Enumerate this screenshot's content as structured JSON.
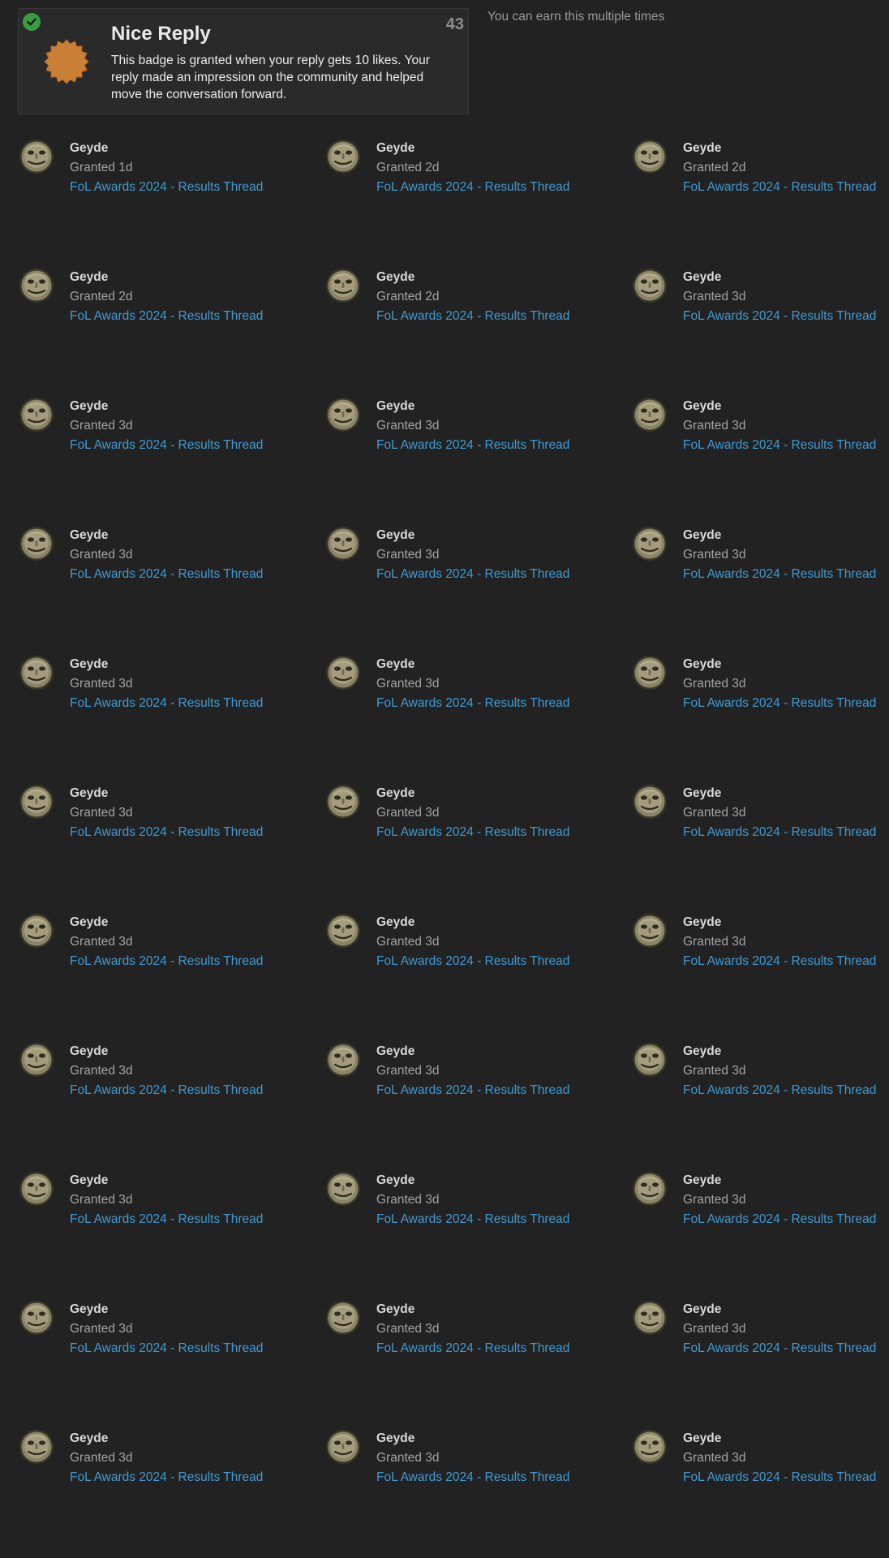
{
  "badge": {
    "title": "Nice Reply",
    "description": "This badge is granted when your reply gets 10 likes. Your reply made an impression on the community and helped move the conversation forward.",
    "count": "43",
    "granted_icon": "check-circle-icon",
    "icon": "badge-starburst-icon",
    "icon_color": "#c97f36",
    "earn_note": "You can earn this multiple times"
  },
  "colors": {
    "background": "#222222",
    "link": "#3f9bd4",
    "check": "#3c9a43"
  },
  "users": [
    {
      "username": "Geyde",
      "granted": "Granted 1d",
      "topic": "FoL Awards 2024 - Results Thread"
    },
    {
      "username": "Geyde",
      "granted": "Granted 2d",
      "topic": "FoL Awards 2024 - Results Thread"
    },
    {
      "username": "Geyde",
      "granted": "Granted 2d",
      "topic": "FoL Awards 2024 - Results Thread"
    },
    {
      "username": "Geyde",
      "granted": "Granted 2d",
      "topic": "FoL Awards 2024 - Results Thread"
    },
    {
      "username": "Geyde",
      "granted": "Granted 2d",
      "topic": "FoL Awards 2024 - Results Thread"
    },
    {
      "username": "Geyde",
      "granted": "Granted 3d",
      "topic": "FoL Awards 2024 - Results Thread"
    },
    {
      "username": "Geyde",
      "granted": "Granted 3d",
      "topic": "FoL Awards 2024 - Results Thread"
    },
    {
      "username": "Geyde",
      "granted": "Granted 3d",
      "topic": "FoL Awards 2024 - Results Thread"
    },
    {
      "username": "Geyde",
      "granted": "Granted 3d",
      "topic": "FoL Awards 2024 - Results Thread"
    },
    {
      "username": "Geyde",
      "granted": "Granted 3d",
      "topic": "FoL Awards 2024 - Results Thread"
    },
    {
      "username": "Geyde",
      "granted": "Granted 3d",
      "topic": "FoL Awards 2024 - Results Thread"
    },
    {
      "username": "Geyde",
      "granted": "Granted 3d",
      "topic": "FoL Awards 2024 - Results Thread"
    },
    {
      "username": "Geyde",
      "granted": "Granted 3d",
      "topic": "FoL Awards 2024 - Results Thread"
    },
    {
      "username": "Geyde",
      "granted": "Granted 3d",
      "topic": "FoL Awards 2024 - Results Thread"
    },
    {
      "username": "Geyde",
      "granted": "Granted 3d",
      "topic": "FoL Awards 2024 - Results Thread"
    },
    {
      "username": "Geyde",
      "granted": "Granted 3d",
      "topic": "FoL Awards 2024 - Results Thread"
    },
    {
      "username": "Geyde",
      "granted": "Granted 3d",
      "topic": "FoL Awards 2024 - Results Thread"
    },
    {
      "username": "Geyde",
      "granted": "Granted 3d",
      "topic": "FoL Awards 2024 - Results Thread"
    },
    {
      "username": "Geyde",
      "granted": "Granted 3d",
      "topic": "FoL Awards 2024 - Results Thread"
    },
    {
      "username": "Geyde",
      "granted": "Granted 3d",
      "topic": "FoL Awards 2024 - Results Thread"
    },
    {
      "username": "Geyde",
      "granted": "Granted 3d",
      "topic": "FoL Awards 2024 - Results Thread"
    },
    {
      "username": "Geyde",
      "granted": "Granted 3d",
      "topic": "FoL Awards 2024 - Results Thread"
    },
    {
      "username": "Geyde",
      "granted": "Granted 3d",
      "topic": "FoL Awards 2024 - Results Thread"
    },
    {
      "username": "Geyde",
      "granted": "Granted 3d",
      "topic": "FoL Awards 2024 - Results Thread"
    },
    {
      "username": "Geyde",
      "granted": "Granted 3d",
      "topic": "FoL Awards 2024 - Results Thread"
    },
    {
      "username": "Geyde",
      "granted": "Granted 3d",
      "topic": "FoL Awards 2024 - Results Thread"
    },
    {
      "username": "Geyde",
      "granted": "Granted 3d",
      "topic": "FoL Awards 2024 - Results Thread"
    },
    {
      "username": "Geyde",
      "granted": "Granted 3d",
      "topic": "FoL Awards 2024 - Results Thread"
    },
    {
      "username": "Geyde",
      "granted": "Granted 3d",
      "topic": "FoL Awards 2024 - Results Thread"
    },
    {
      "username": "Geyde",
      "granted": "Granted 3d",
      "topic": "FoL Awards 2024 - Results Thread"
    },
    {
      "username": "Geyde",
      "granted": "Granted 3d",
      "topic": "FoL Awards 2024 - Results Thread"
    },
    {
      "username": "Geyde",
      "granted": "Granted 3d",
      "topic": "FoL Awards 2024 - Results Thread"
    },
    {
      "username": "Geyde",
      "granted": "Granted 3d",
      "topic": "FoL Awards 2024 - Results Thread"
    }
  ]
}
